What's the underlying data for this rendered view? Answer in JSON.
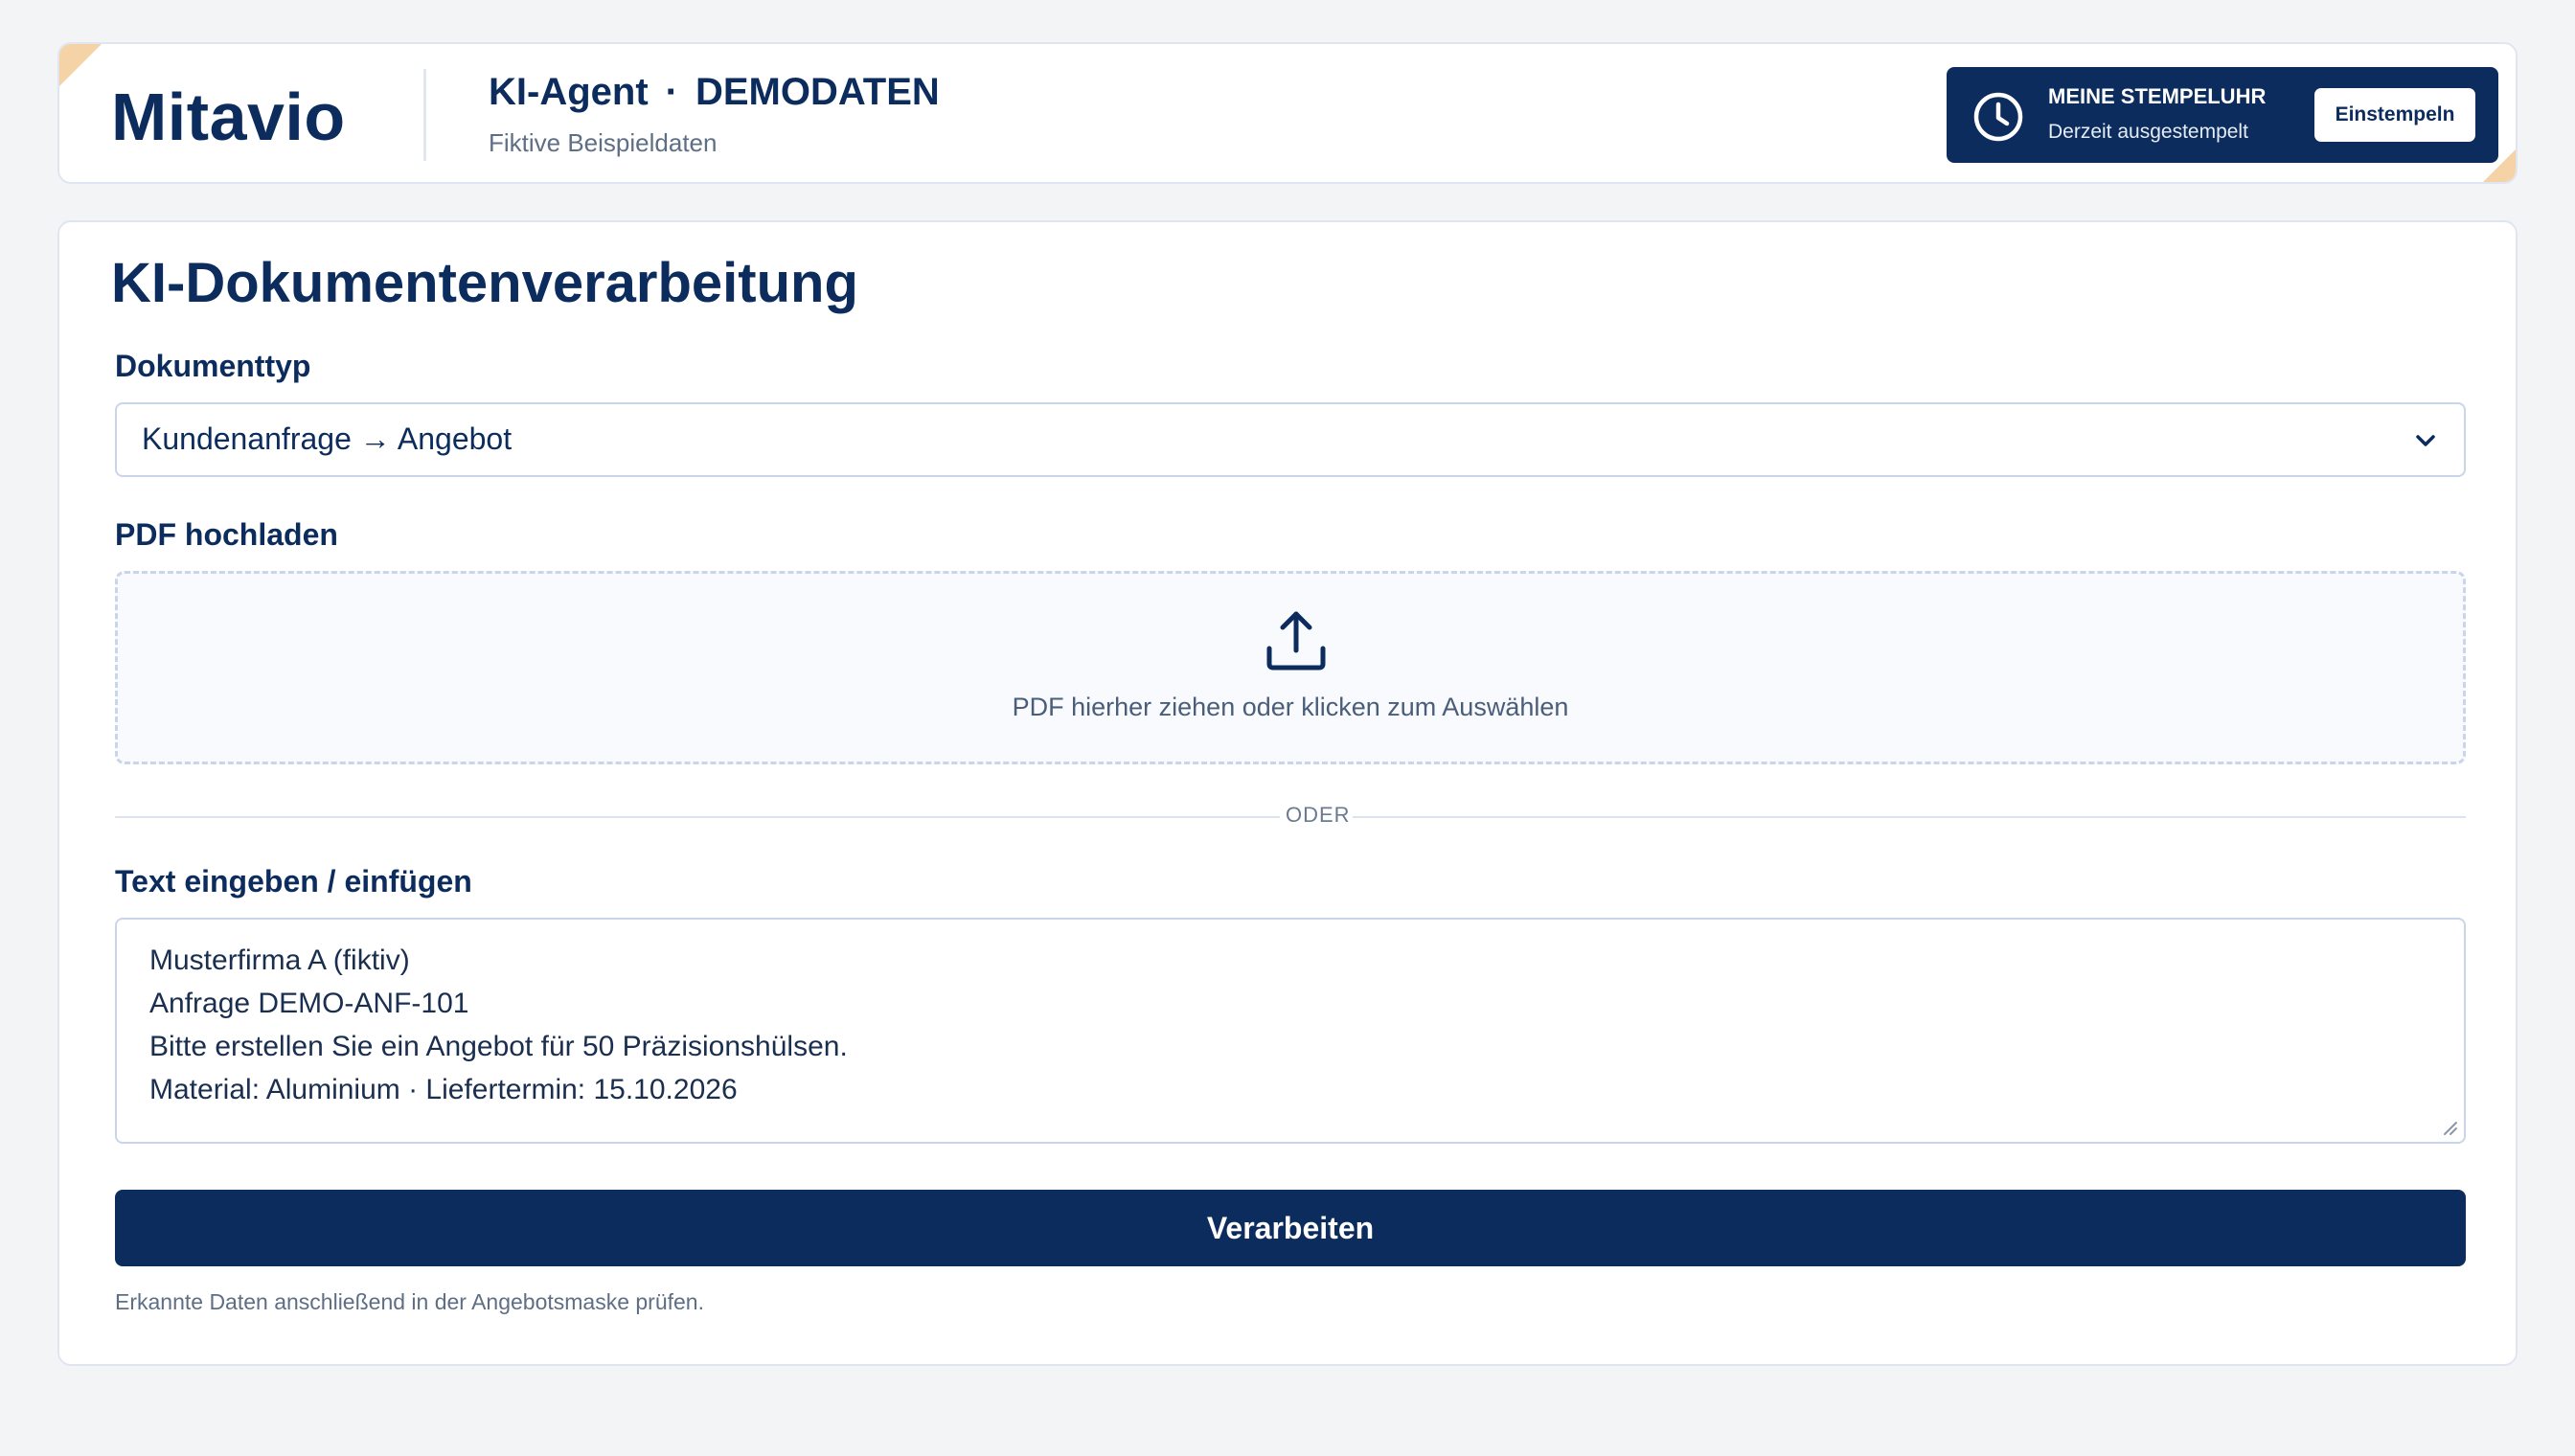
{
  "header": {
    "logo": "Mitavio",
    "agent": "KI-Agent",
    "separator": "·",
    "badge": "DEMODATEN",
    "subtitle": "Fiktive Beispieldaten",
    "stempeluhr": {
      "label": "MEINE STEMPELUHR",
      "status": "Derzeit ausgestempelt",
      "button": "Einstempeln",
      "icon": "clock-icon"
    }
  },
  "main": {
    "title": "KI-Dokumentenverarbeitung",
    "doc_type": {
      "label": "Dokumenttyp",
      "selected": "Kundenanfrage → Angebot",
      "icon": "chevron-down-icon"
    },
    "upload": {
      "label": "PDF hochladen",
      "text": "PDF hierher ziehen oder klicken zum Auswählen",
      "icon": "upload-icon"
    },
    "separator": "ODER",
    "text_input": {
      "label": "Text eingeben / einfügen",
      "lines": [
        "Musterfirma A (fiktiv)",
        "Anfrage DEMO-ANF-101",
        "Bitte erstellen Sie ein Angebot für 50 Präzisionshülsen.",
        "Material: Aluminium · Liefertermin: 15.10.2026"
      ]
    },
    "submit": "Verarbeiten",
    "hint": "Erkannte Daten anschließend in der Angebotsmaske prüfen."
  },
  "colors": {
    "primary": "#0b2c5c",
    "accent_corner": "#f5d3a6",
    "border": "#c9d6e9",
    "background": "#f3f4f6"
  }
}
